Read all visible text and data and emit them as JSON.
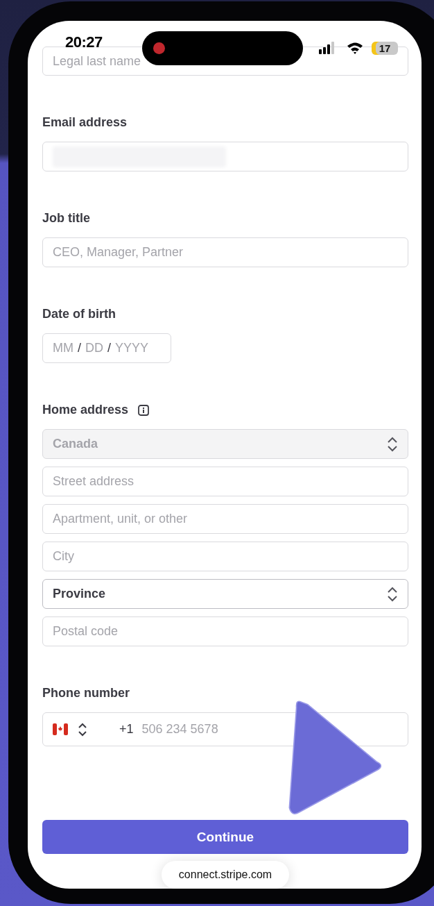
{
  "status_bar": {
    "time": "20:27",
    "recording": true,
    "battery": "17"
  },
  "top_field": {
    "placeholder": "Legal last name"
  },
  "sections": [
    {
      "label": "Email address",
      "info": false,
      "inputs": [
        {
          "kind": "redacted"
        }
      ]
    },
    {
      "label": "Job title",
      "info": false,
      "inputs": [
        {
          "kind": "text",
          "placeholder": "CEO, Manager, Partner"
        }
      ]
    },
    {
      "label": "Date of birth",
      "info": false,
      "inputs": [
        {
          "kind": "date",
          "parts": [
            "MM",
            "DD",
            "YYYY"
          ],
          "separators": [
            "/",
            "/"
          ]
        }
      ]
    },
    {
      "label": "Home address",
      "info": true,
      "inputs": [
        {
          "kind": "select",
          "value": "Canada",
          "disabled": true
        },
        {
          "kind": "text",
          "placeholder": "Street address"
        },
        {
          "kind": "text",
          "placeholder": "Apartment, unit, or other"
        },
        {
          "kind": "text",
          "placeholder": "City"
        },
        {
          "kind": "select",
          "value": "Province",
          "disabled": false
        },
        {
          "kind": "text",
          "placeholder": "Postal code"
        }
      ]
    },
    {
      "label": "Phone number",
      "info": false,
      "inputs": [
        {
          "kind": "phone",
          "code": "+1",
          "placeholder": "506 234 5678"
        }
      ]
    }
  ],
  "button": "Continue",
  "url": "connect.stripe.com"
}
